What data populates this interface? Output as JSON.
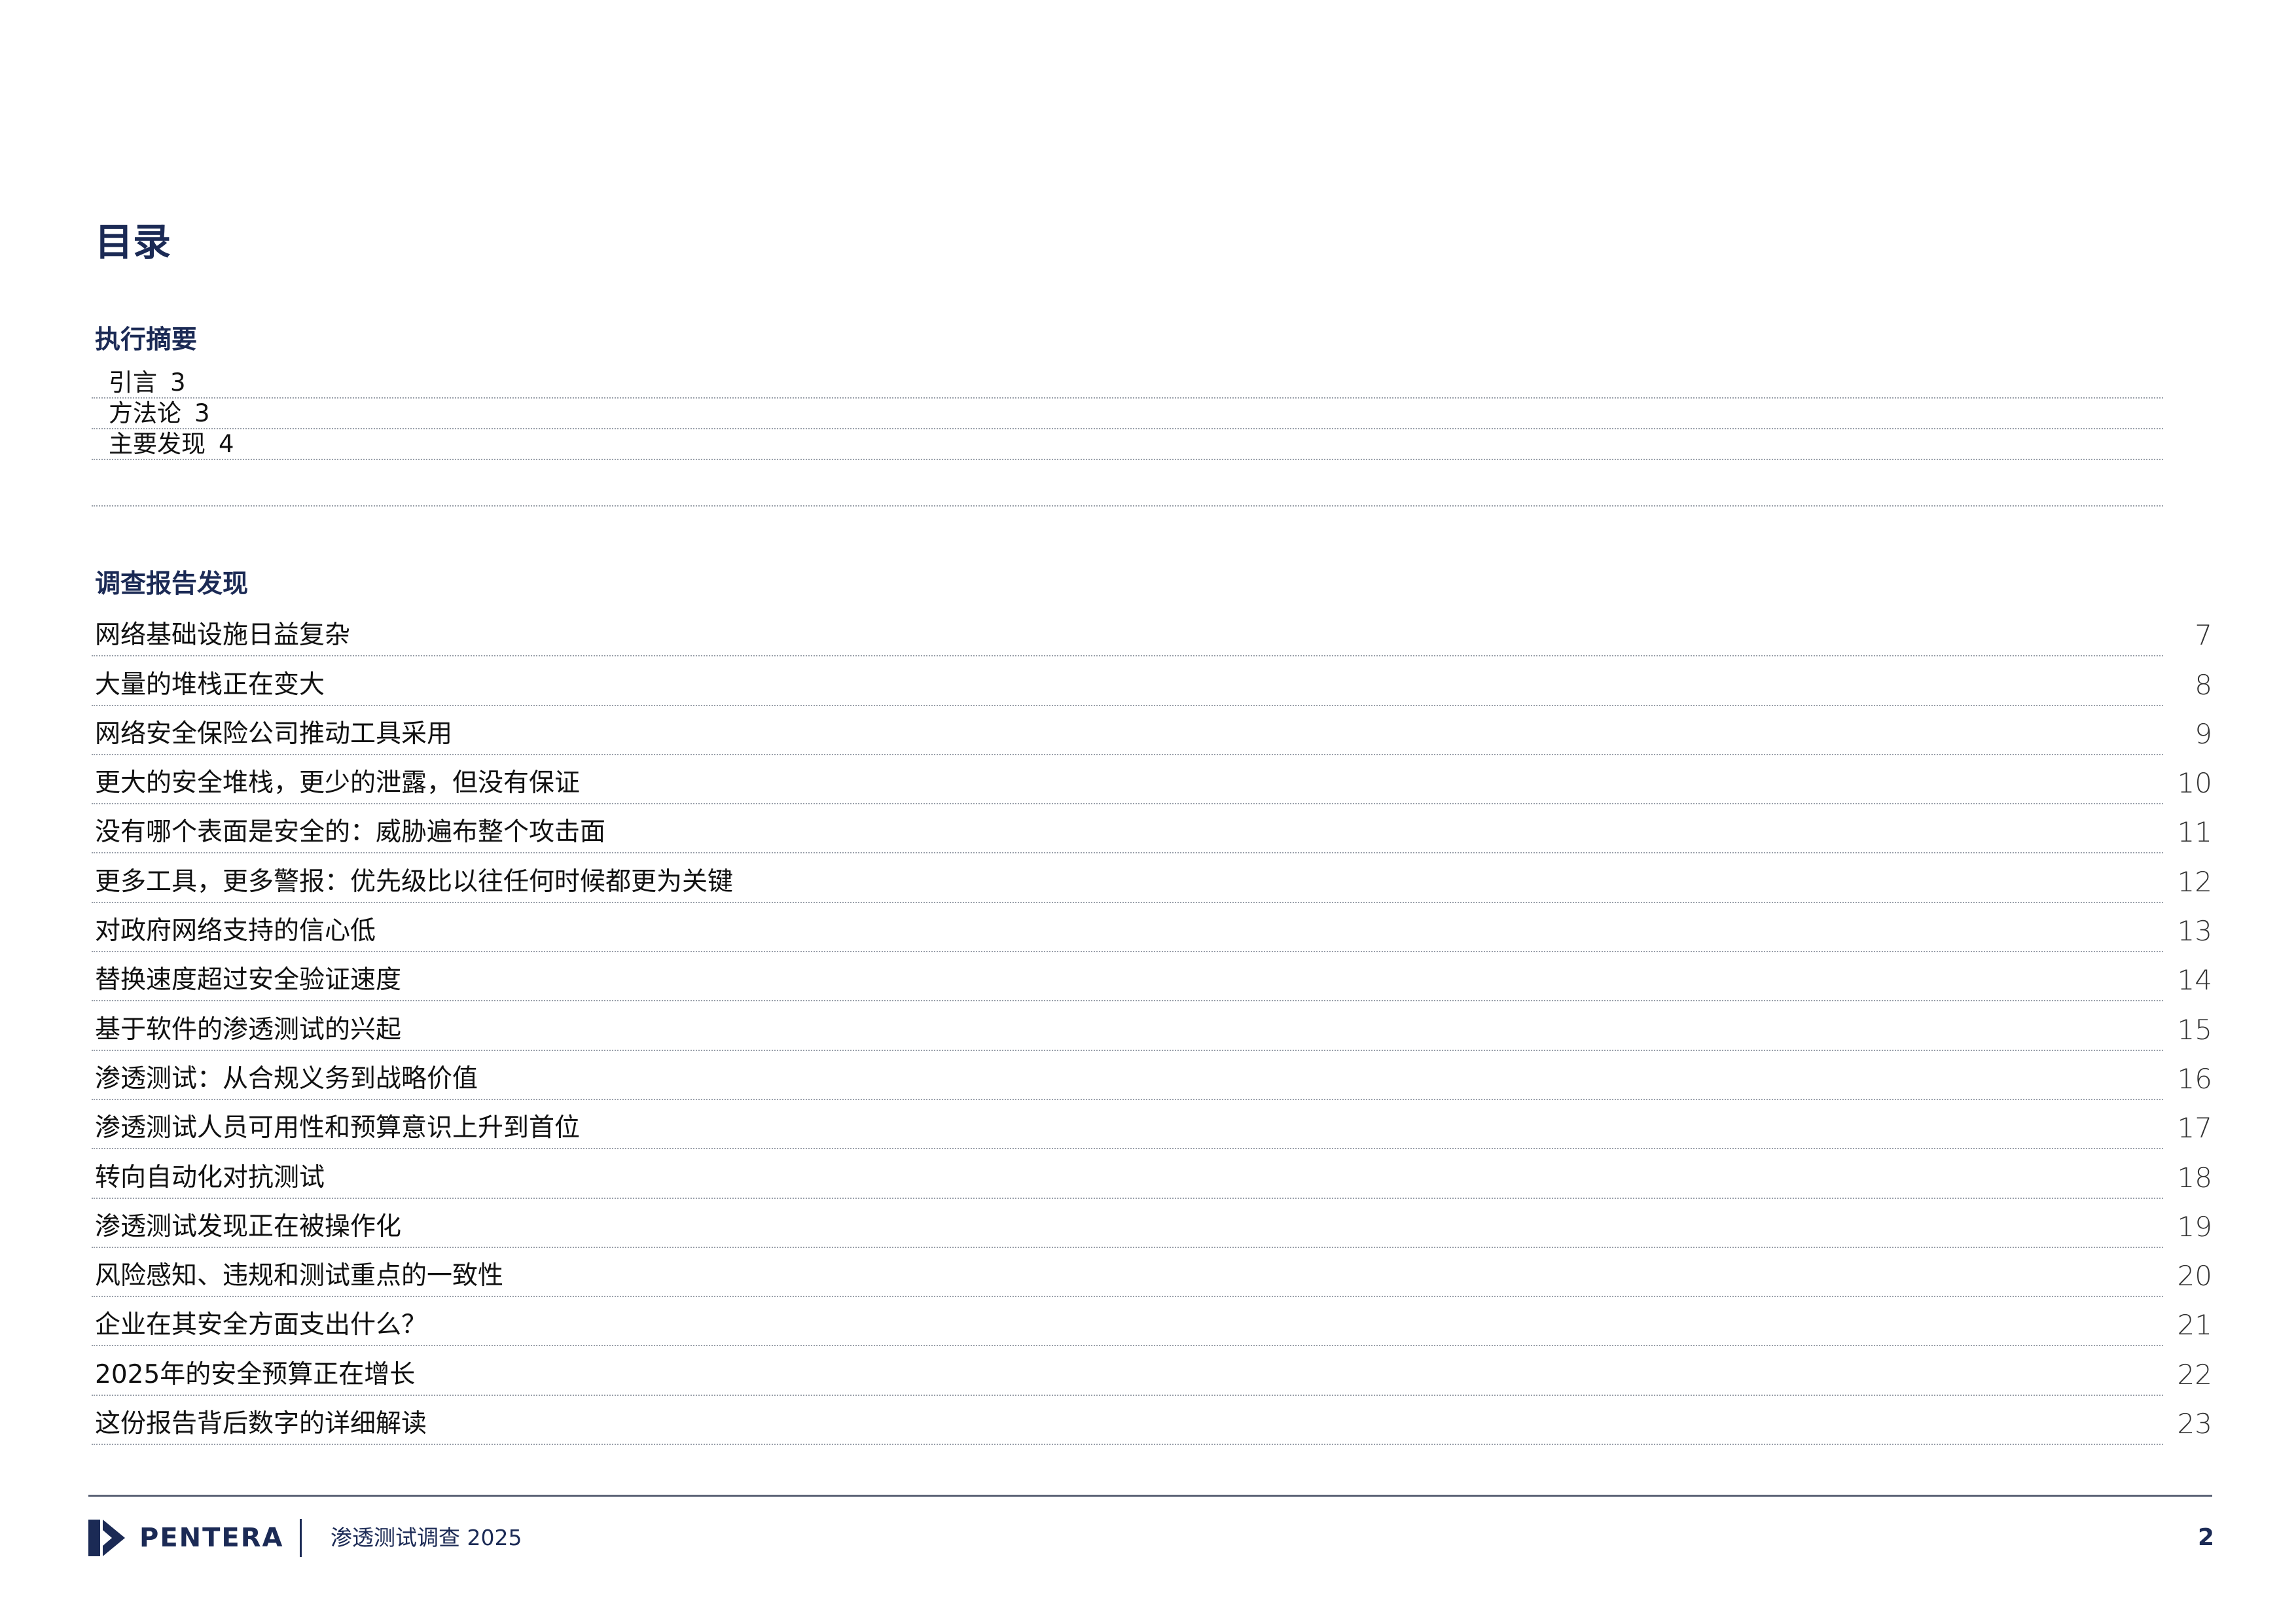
{
  "title": "目录",
  "executive_summary": {
    "heading": "执行摘要",
    "items": [
      {
        "label": "引言",
        "page": "3"
      },
      {
        "label": "方法论",
        "page": "3"
      },
      {
        "label": "主要发现",
        "page": "4"
      }
    ]
  },
  "findings": {
    "heading": "调查报告发现",
    "items": [
      {
        "label": "网络基础设施日益复杂",
        "page": "7"
      },
      {
        "label": "大量的堆栈正在变大",
        "page": "8"
      },
      {
        "label": "网络安全保险公司推动工具采用",
        "page": "9"
      },
      {
        "label": "更大的安全堆栈，更少的泄露，但没有保证",
        "page": "10"
      },
      {
        "label": "没有哪个表面是安全的：威胁遍布整个攻击面",
        "page": "11"
      },
      {
        "label": "更多工具，更多警报：优先级比以往任何时候都更为关键",
        "page": "12"
      },
      {
        "label": "对政府网络支持的信心低",
        "page": "13"
      },
      {
        "label": "替换速度超过安全验证速度",
        "page": "14"
      },
      {
        "label": "基于软件的渗透测试的兴起",
        "page": "15"
      },
      {
        "label": "渗透测试：从合规义务到战略价值",
        "page": "16"
      },
      {
        "label": "渗透测试人员可用性和预算意识上升到首位",
        "page": "17"
      },
      {
        "label": "转向自动化对抗测试",
        "page": "18"
      },
      {
        "label": "渗透测试发现正在被操作化",
        "page": "19"
      },
      {
        "label": "风险感知、违规和测试重点的一致性",
        "page": "20"
      },
      {
        "label": "企业在其安全方面支出什么？",
        "page": "21"
      },
      {
        "label": "2025年的安全预算正在增长",
        "page": "22"
      },
      {
        "label": "这份报告背后数字的详细解读",
        "page": "23"
      }
    ]
  },
  "footer": {
    "logo_text": "PENTERA",
    "doc_title": "渗透测试调查 2025",
    "page_number": "2"
  },
  "colors": {
    "brand_navy": "#1b2a55",
    "dotted_rule": "#9aa0aa"
  }
}
